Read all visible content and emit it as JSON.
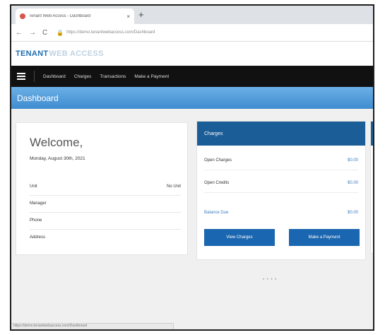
{
  "browser": {
    "tab_title": "Tenant Web Access - Dashboard",
    "tab_close": "×",
    "new_tab": "+",
    "url": "https://demo.tenantwebaccess.com/Dashboard"
  },
  "site": {
    "logo_primary": "TENANT",
    "logo_secondary": "WEB ACCESS"
  },
  "nav": {
    "items": [
      "Dashboard",
      "Charges",
      "Transactions",
      "Make a Payment"
    ]
  },
  "page": {
    "title": "Dashboard"
  },
  "welcome": {
    "title": "Welcome,",
    "date": "Monday, August 30th, 2021",
    "rows": [
      {
        "label": "Unit",
        "value": "No Unit"
      },
      {
        "label": "Manager",
        "value": ""
      },
      {
        "label": "Phone",
        "value": ""
      },
      {
        "label": "Address",
        "value": ""
      }
    ]
  },
  "charges": {
    "title": "Charges",
    "open_charges_label": "Open Charges",
    "open_charges_value": "$0.00",
    "open_credits_label": "Open Credits",
    "open_credits_value": "$0.00",
    "balance_label": "Balance Due",
    "balance_value": "$0.00",
    "view_button": "View Charges",
    "pay_button": "Make a Payment"
  },
  "footer": {
    "dots": "• • • •"
  },
  "status_bar": {
    "text": "https://demo.tenantwebaccess.com/Dashboard"
  },
  "colors": {
    "nav_bg": "#111111",
    "banner": "#4a96d8",
    "card_header": "#1b5d97",
    "button": "#1b66b0",
    "link": "#3c7fc0"
  }
}
